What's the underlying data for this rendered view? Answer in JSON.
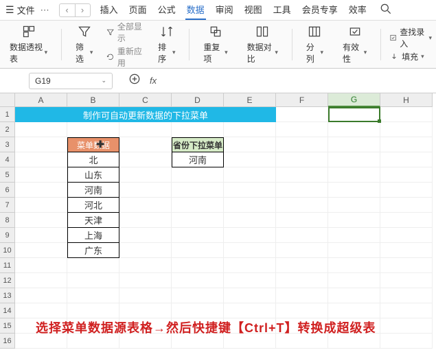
{
  "menu": {
    "file": "文件"
  },
  "tabs": [
    "插入",
    "页面",
    "公式",
    "数据",
    "审阅",
    "视图",
    "工具",
    "会员专享",
    "效率"
  ],
  "activeTab": "数据",
  "ribbon": {
    "pivot": "数据透视表",
    "filter": "筛选",
    "showAll": "全部显示",
    "reapply": "重新应用",
    "sort": "排序",
    "dup": "重复项",
    "compare": "数据对比",
    "split": "分列",
    "validation": "有效性",
    "findEnter": "查找录入",
    "fill": "填充"
  },
  "namebox": "G19",
  "cols": [
    "A",
    "B",
    "C",
    "D",
    "E",
    "F",
    "G",
    "H"
  ],
  "rowCount": 16,
  "title": "制作可自动更新数据的下拉菜单",
  "menuHeader": "菜单数据",
  "menuData": [
    "北",
    "山东",
    "河南",
    "河北",
    "天津",
    "上海",
    "广东"
  ],
  "ddHeader": "省份下拉菜单",
  "ddValue": "河南",
  "instruction": "选择菜单数据源表格→然后快捷键【Ctrl+T】转换成超级表"
}
